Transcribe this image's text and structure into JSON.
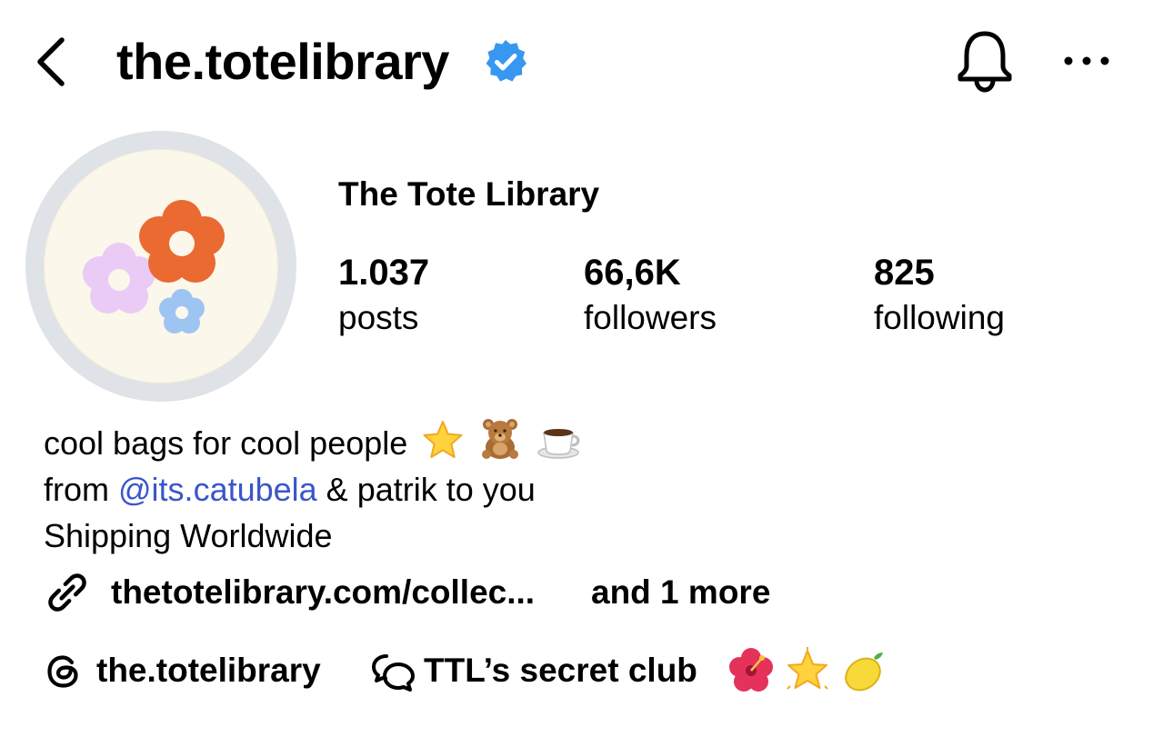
{
  "header": {
    "username": "the.totelibrary",
    "verified": true,
    "icons": [
      "chevron-left-icon",
      "verified-badge-icon",
      "bell-icon",
      "more-horizontal-icon"
    ]
  },
  "profile": {
    "display_name": "The Tote Library",
    "stats": [
      {
        "value": "1.037",
        "label": "posts"
      },
      {
        "value": "66,6K",
        "label": "followers"
      },
      {
        "value": "825",
        "label": "following"
      }
    ]
  },
  "bio": {
    "line1": "cool bags for cool people",
    "line1_emojis": [
      "star-emoji",
      "teddy-bear-emoji",
      "coffee-emoji"
    ],
    "line2_prefix": "from ",
    "line2_mention": "@its.catubela",
    "line2_suffix": " & patrik to you",
    "line3": "Shipping Worldwide"
  },
  "links": {
    "primary": "thetotelibrary.com/collec...",
    "more": "and 1 more"
  },
  "threads": {
    "handle": "the.totelibrary"
  },
  "channel": {
    "name": "TTL’s secret club",
    "emojis": [
      "hibiscus-emoji",
      "glowing-star-emoji",
      "lemon-emoji"
    ]
  },
  "colors": {
    "verified_blue": "#3897f0",
    "mention_blue": "#3a56c8",
    "avatar_ring": "#dfe2e7",
    "avatar_bg": "#fbf7ea",
    "flower_orange": "#ea6a32",
    "flower_lilac": "#e9cbf6",
    "flower_blue": "#9ec4f2"
  }
}
